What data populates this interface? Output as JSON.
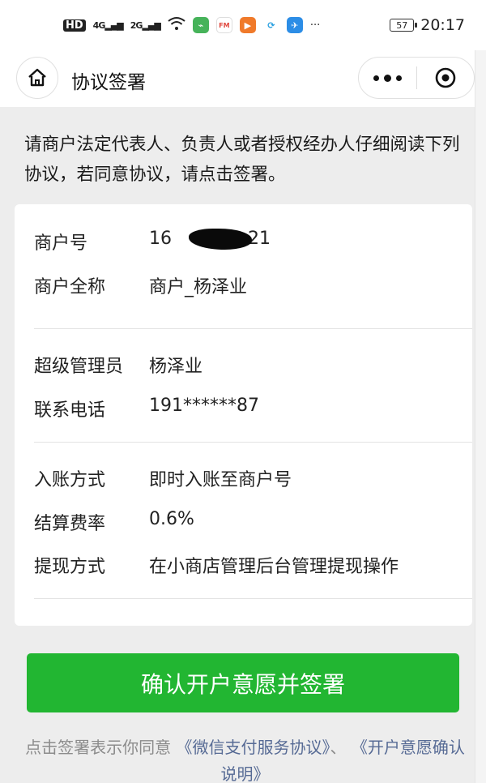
{
  "status_bar": {
    "hd": "HD",
    "net1": "4G",
    "net2": "2G",
    "app_fm": "FM",
    "more": "···",
    "battery": "57",
    "time": "20:17"
  },
  "nav": {
    "title": "协议签署"
  },
  "intro_text": "请商户法定代表人、负责人或者授权经办人仔细阅读下列协议，若同意协议，请点击签署。",
  "merchant": {
    "id_label": "商户号",
    "id_prefix": "16",
    "id_suffix": "21",
    "name_label": "商户全称",
    "name_value": "商户_杨泽业"
  },
  "admin": {
    "label": "超级管理员",
    "value": "杨泽业",
    "phone_label": "联系电话",
    "phone_value": "191******87"
  },
  "settlement": {
    "method_label": "入账方式",
    "method_value": "即时入账至商户号",
    "rate_label": "结算费率",
    "rate_value": "0.6%",
    "withdraw_label": "提现方式",
    "withdraw_value": "在小商店管理后台管理提现操作"
  },
  "confirm_button": "确认开户意愿并签署",
  "agreement": {
    "prefix": "点击签署表示你同意",
    "link1": "《微信支付服务协议》",
    "sep": "、",
    "link2": "《开户意愿确认说明》"
  },
  "colors": {
    "primary": "#22b632",
    "link": "#576b95",
    "background": "#ededed"
  }
}
